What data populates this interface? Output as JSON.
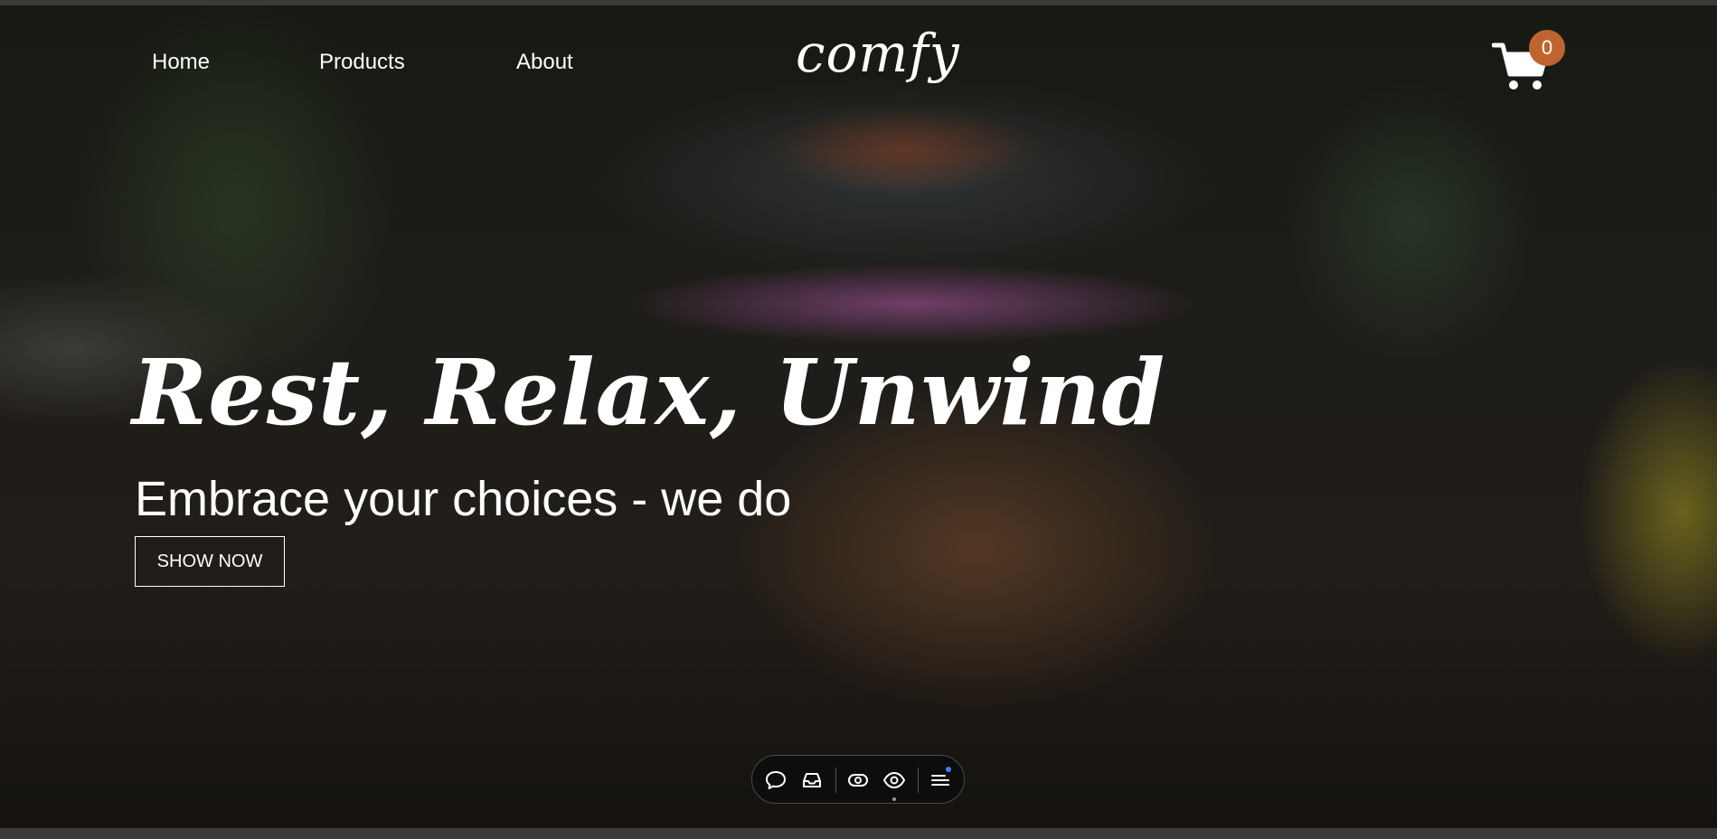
{
  "nav": {
    "links": [
      {
        "label": "Home"
      },
      {
        "label": "Products"
      },
      {
        "label": "About"
      }
    ],
    "logo": "comfy",
    "cart": {
      "count": "0",
      "icon": "shopping-cart-icon",
      "badge_color": "#c0642f"
    }
  },
  "hero": {
    "title": "Rest, Relax, Unwind",
    "subtitle": "Embrace your choices - we do",
    "cta_label": "SHOW NOW"
  },
  "toolbar": {
    "buttons": [
      {
        "icon": "chat-bubble-icon"
      },
      {
        "icon": "inbox-icon"
      },
      {
        "icon": "toggle-view-icon"
      },
      {
        "icon": "eye-icon"
      },
      {
        "icon": "menu-icon"
      }
    ],
    "badge_color": "#3b82f6"
  }
}
